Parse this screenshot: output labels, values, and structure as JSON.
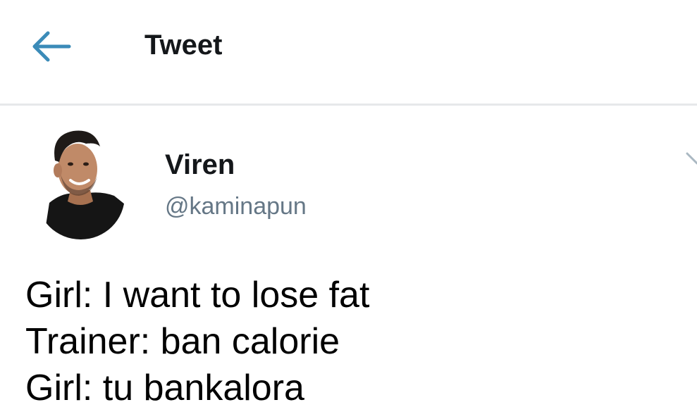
{
  "header": {
    "back_icon": "arrow-left-icon",
    "title": "Tweet",
    "accent_color": "#3b8bb8"
  },
  "tweet": {
    "author": {
      "name": "Viren",
      "handle": "@kaminapun",
      "avatar_icon": "user-avatar"
    },
    "menu_icon": "chevron-down-icon",
    "text_lines": [
      "Girl: I want to lose fat",
      "Trainer: ban calorie",
      "Girl: tu bankalora"
    ]
  }
}
